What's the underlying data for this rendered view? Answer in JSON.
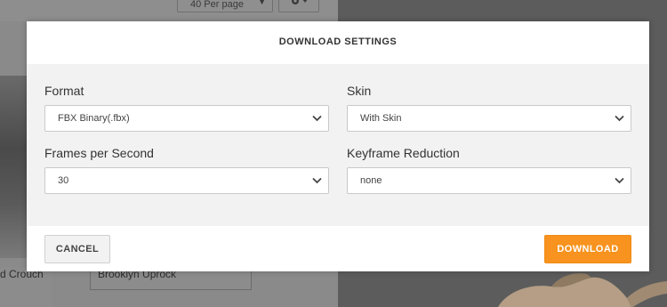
{
  "background": {
    "per_page_label": "40 Per page",
    "card_labels": [
      "d Crouch",
      "Brooklyn Uprock"
    ]
  },
  "dialog": {
    "title": "DOWNLOAD SETTINGS",
    "fields": {
      "format": {
        "label": "Format",
        "value": "FBX Binary(.fbx)"
      },
      "skin": {
        "label": "Skin",
        "value": "With Skin"
      },
      "fps": {
        "label": "Frames per Second",
        "value": "30"
      },
      "keyframe": {
        "label": "Keyframe Reduction",
        "value": "none"
      }
    },
    "buttons": {
      "cancel": "CANCEL",
      "download": "DOWNLOAD"
    }
  },
  "colors": {
    "accent": "#f7931e",
    "overlay": "#7d7d7d",
    "body_bg": "#f2f2f2"
  },
  "icons": {
    "select_arrow": "chevron-down-icon",
    "settings": "gear-icon"
  }
}
